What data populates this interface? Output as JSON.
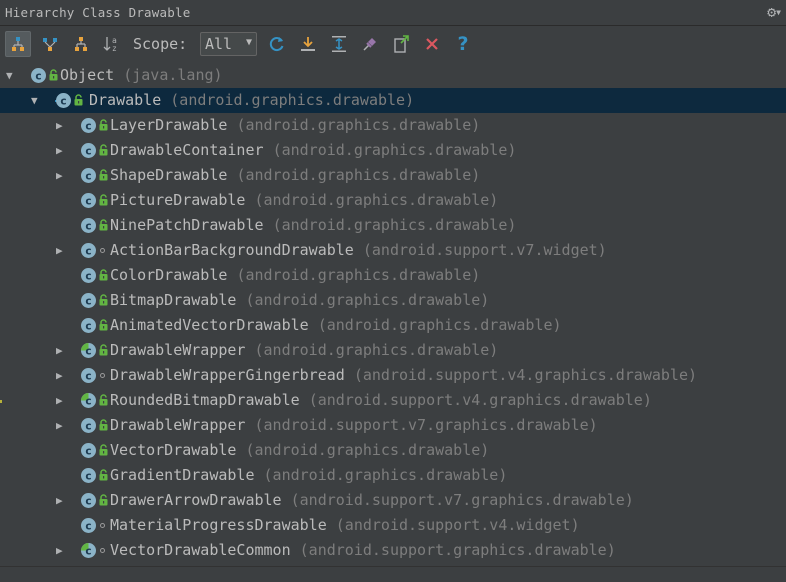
{
  "window": {
    "title": "Hierarchy Class Drawable"
  },
  "toolbar": {
    "scope_label": "Scope:",
    "scope_value": "All",
    "buttons": [
      {
        "icon": "type-hierarchy-icon",
        "active": true
      },
      {
        "icon": "subtypes-hierarchy-icon",
        "active": false
      },
      {
        "icon": "supertypes-hierarchy-icon",
        "active": false
      },
      {
        "icon": "sort-alphabetically-icon",
        "active": false
      },
      {
        "icon": "refresh-icon",
        "active": false
      },
      {
        "icon": "autoscroll-to-source-icon",
        "active": false
      },
      {
        "icon": "expand-all-icon",
        "active": false
      },
      {
        "icon": "pin-icon",
        "active": false
      },
      {
        "icon": "export-icon",
        "active": false
      },
      {
        "icon": "close-icon",
        "active": false
      },
      {
        "icon": "help-icon",
        "active": false
      }
    ]
  },
  "colors": {
    "background": "#3c3f41",
    "selection": "#0d293e",
    "class_icon": "#3592c4",
    "lock": "#62b543",
    "package_text": "#7d7d7d",
    "refresh": "#3592c4",
    "close": "#db5860",
    "help": "#3592c4"
  },
  "tree": [
    {
      "name": "Object",
      "pkg": "(java.lang)",
      "depth": 0,
      "expand": "expanded",
      "icon": "class",
      "access": "lock",
      "selected": false
    },
    {
      "name": "Drawable",
      "pkg": "(android.graphics.drawable)",
      "depth": 1,
      "expand": "expanded",
      "icon": "abstract-class-base",
      "access": "lock",
      "selected": true
    },
    {
      "name": "LayerDrawable",
      "pkg": "(android.graphics.drawable)",
      "depth": 2,
      "expand": "collapsed",
      "icon": "class",
      "access": "lock",
      "selected": false
    },
    {
      "name": "DrawableContainer",
      "pkg": "(android.graphics.drawable)",
      "depth": 2,
      "expand": "collapsed",
      "icon": "class",
      "access": "lock",
      "selected": false
    },
    {
      "name": "ShapeDrawable",
      "pkg": "(android.graphics.drawable)",
      "depth": 2,
      "expand": "collapsed",
      "icon": "class",
      "access": "lock",
      "selected": false
    },
    {
      "name": "PictureDrawable",
      "pkg": "(android.graphics.drawable)",
      "depth": 2,
      "expand": "none",
      "icon": "class",
      "access": "lock",
      "selected": false
    },
    {
      "name": "NinePatchDrawable",
      "pkg": "(android.graphics.drawable)",
      "depth": 2,
      "expand": "none",
      "icon": "class",
      "access": "lock",
      "selected": false
    },
    {
      "name": "ActionBarBackgroundDrawable",
      "pkg": "(android.support.v7.widget)",
      "depth": 2,
      "expand": "collapsed",
      "icon": "class",
      "access": "package",
      "selected": false
    },
    {
      "name": "ColorDrawable",
      "pkg": "(android.graphics.drawable)",
      "depth": 2,
      "expand": "none",
      "icon": "class",
      "access": "lock",
      "selected": false
    },
    {
      "name": "BitmapDrawable",
      "pkg": "(android.graphics.drawable)",
      "depth": 2,
      "expand": "none",
      "icon": "class",
      "access": "lock",
      "selected": false
    },
    {
      "name": "AnimatedVectorDrawable",
      "pkg": "(android.graphics.drawable)",
      "depth": 2,
      "expand": "none",
      "icon": "class",
      "access": "lock",
      "selected": false
    },
    {
      "name": "DrawableWrapper",
      "pkg": "(android.graphics.drawable)",
      "depth": 2,
      "expand": "collapsed",
      "icon": "abstract-class",
      "access": "lock",
      "selected": false
    },
    {
      "name": "DrawableWrapperGingerbread",
      "pkg": "(android.support.v4.graphics.drawable)",
      "depth": 2,
      "expand": "collapsed",
      "icon": "class",
      "access": "package",
      "selected": false
    },
    {
      "name": "RoundedBitmapDrawable",
      "pkg": "(android.support.v4.graphics.drawable)",
      "depth": 2,
      "expand": "collapsed",
      "icon": "abstract-class",
      "access": "lock",
      "selected": false
    },
    {
      "name": "DrawableWrapper",
      "pkg": "(android.support.v7.graphics.drawable)",
      "depth": 2,
      "expand": "collapsed",
      "icon": "class",
      "access": "lock",
      "selected": false
    },
    {
      "name": "VectorDrawable",
      "pkg": "(android.graphics.drawable)",
      "depth": 2,
      "expand": "none",
      "icon": "class",
      "access": "lock",
      "selected": false
    },
    {
      "name": "GradientDrawable",
      "pkg": "(android.graphics.drawable)",
      "depth": 2,
      "expand": "none",
      "icon": "class",
      "access": "lock",
      "selected": false
    },
    {
      "name": "DrawerArrowDrawable",
      "pkg": "(android.support.v7.graphics.drawable)",
      "depth": 2,
      "expand": "collapsed",
      "icon": "class",
      "access": "lock",
      "selected": false
    },
    {
      "name": "MaterialProgressDrawable",
      "pkg": "(android.support.v4.widget)",
      "depth": 2,
      "expand": "none",
      "icon": "class",
      "access": "package",
      "selected": false
    },
    {
      "name": "VectorDrawableCommon",
      "pkg": "(android.support.graphics.drawable)",
      "depth": 2,
      "expand": "collapsed",
      "icon": "abstract-class",
      "access": "package",
      "selected": false
    }
  ]
}
